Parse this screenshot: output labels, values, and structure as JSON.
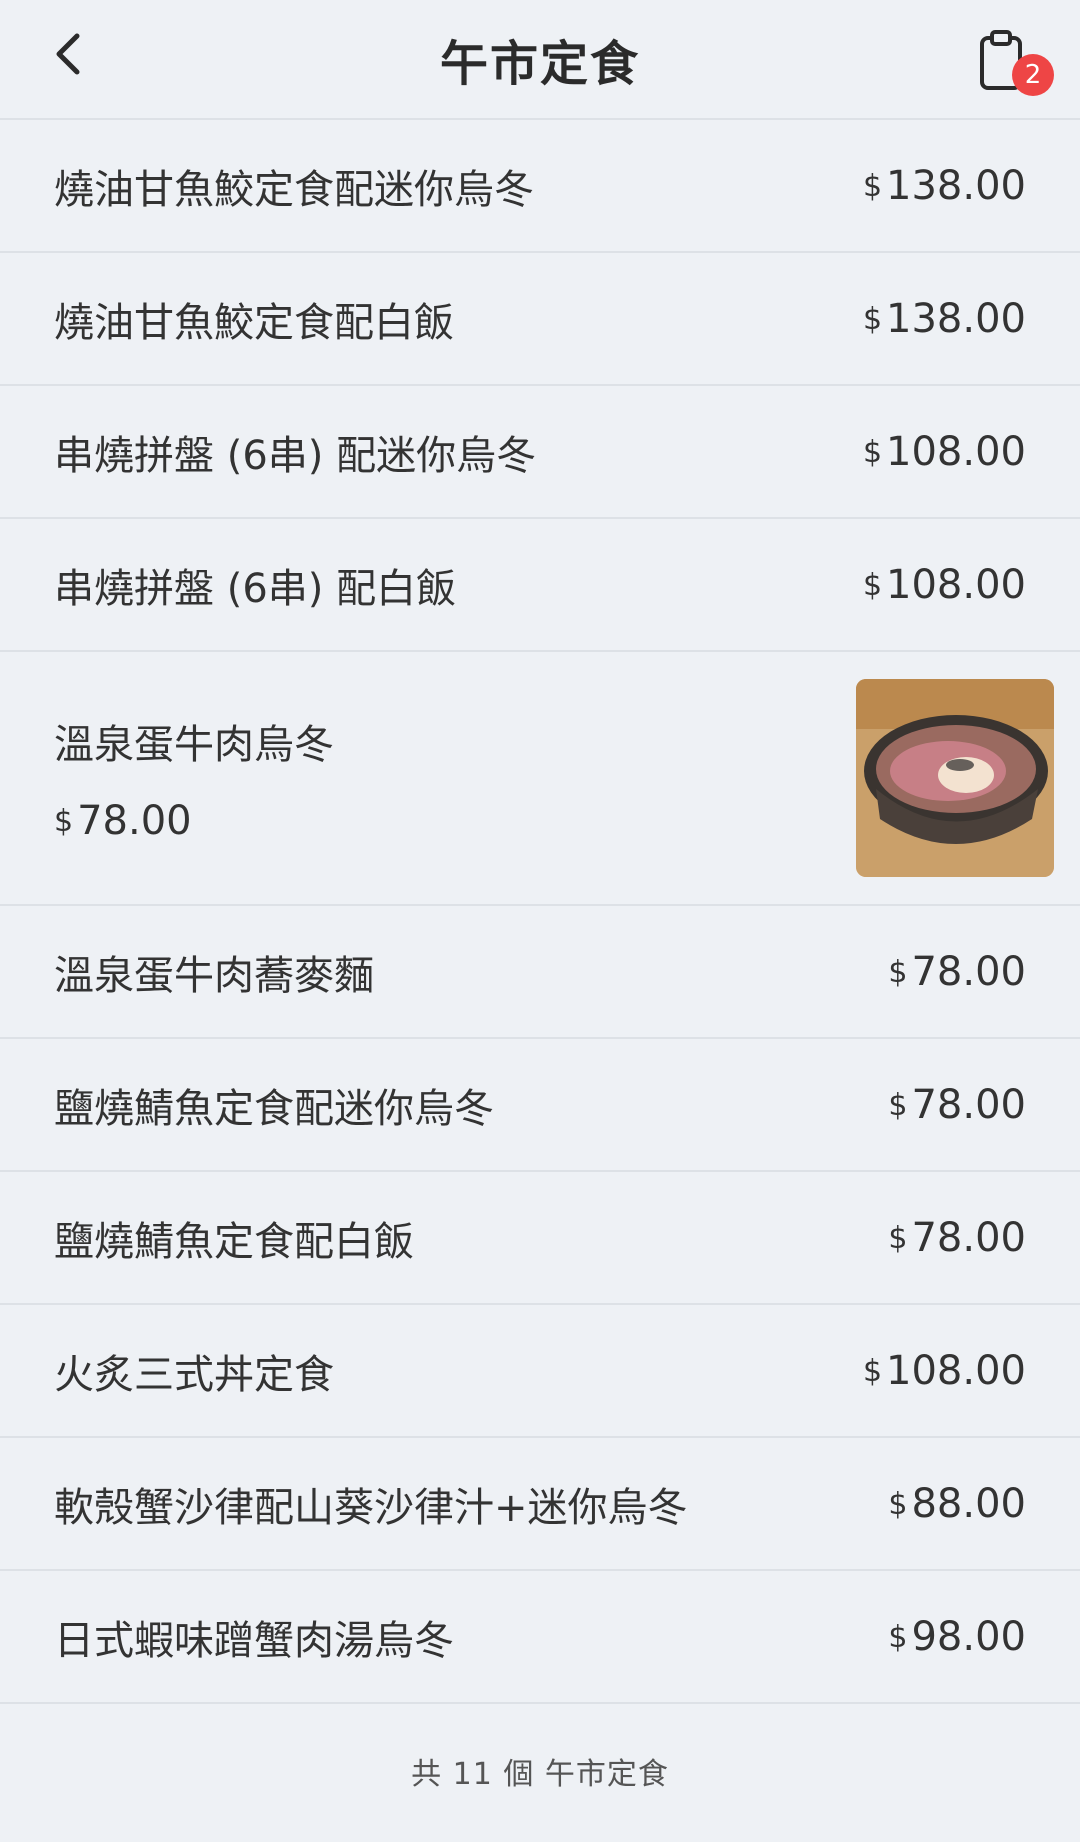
{
  "header": {
    "title": "午市定食",
    "cart_count": "2"
  },
  "currency": "$",
  "items": [
    {
      "name": "燒油甘魚鮫定食配迷你烏冬",
      "price": "138.00"
    },
    {
      "name": "燒油甘魚鮫定食配白飯",
      "price": "138.00"
    },
    {
      "name": "串燒拼盤 (6串) 配迷你烏冬",
      "price": "108.00"
    },
    {
      "name": "串燒拼盤 (6串) 配白飯",
      "price": "108.00"
    },
    {
      "name": "溫泉蛋牛肉烏冬",
      "price": "78.00",
      "has_image": true
    },
    {
      "name": "溫泉蛋牛肉蕎麥麵",
      "price": "78.00"
    },
    {
      "name": "鹽燒鯖魚定食配迷你烏冬",
      "price": "78.00"
    },
    {
      "name": "鹽燒鯖魚定食配白飯",
      "price": "78.00"
    },
    {
      "name": "火炙三式丼定食",
      "price": "108.00"
    },
    {
      "name": "軟殼蟹沙律配山葵沙律汁+迷你烏冬",
      "price": "88.00"
    },
    {
      "name": "日式蝦味蹭蟹肉湯烏冬",
      "price": "98.00"
    }
  ],
  "footer": {
    "summary": "共 11 個 午市定食"
  }
}
